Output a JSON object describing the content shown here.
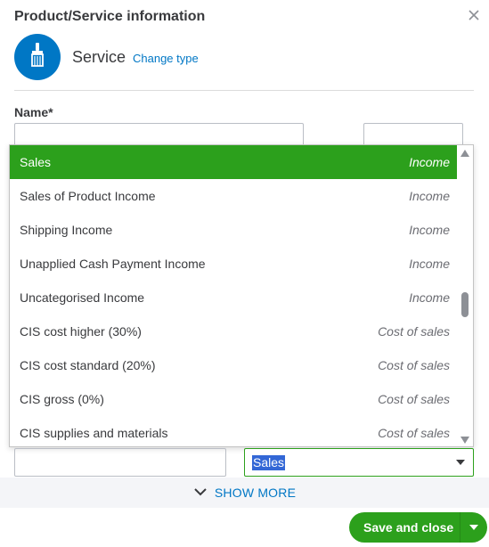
{
  "panel": {
    "title": "Product/Service information",
    "close_icon": "close-icon"
  },
  "item_type": {
    "icon": "brush-icon",
    "label": "Service",
    "change_link": "Change type"
  },
  "form": {
    "name_label": "Name*",
    "name_value": "",
    "sku_value": "",
    "left_field_value": ""
  },
  "account_dropdown": {
    "selected_value": "Sales",
    "items": [
      {
        "name": "Sales",
        "type": "Income",
        "selected": true
      },
      {
        "name": "Sales of Product Income",
        "type": "Income"
      },
      {
        "name": "Shipping Income",
        "type": "Income"
      },
      {
        "name": "Unapplied Cash Payment Income",
        "type": "Income"
      },
      {
        "name": "Uncategorised Income",
        "type": "Income"
      },
      {
        "name": "CIS cost higher (30%)",
        "type": "Cost of sales"
      },
      {
        "name": "CIS cost standard (20%)",
        "type": "Cost of sales"
      },
      {
        "name": "CIS gross (0%)",
        "type": "Cost of sales"
      },
      {
        "name": "CIS supplies and materials",
        "type": "Cost of sales"
      }
    ]
  },
  "show_more": {
    "label": "SHOW MORE",
    "icon": "chevron-down-icon"
  },
  "footer": {
    "save_label": "Save and close",
    "save_menu_icon": "caret-down-icon"
  },
  "colors": {
    "brand_blue": "#0077c5",
    "brand_green": "#2ca01c",
    "highlight": "#3367d6"
  }
}
